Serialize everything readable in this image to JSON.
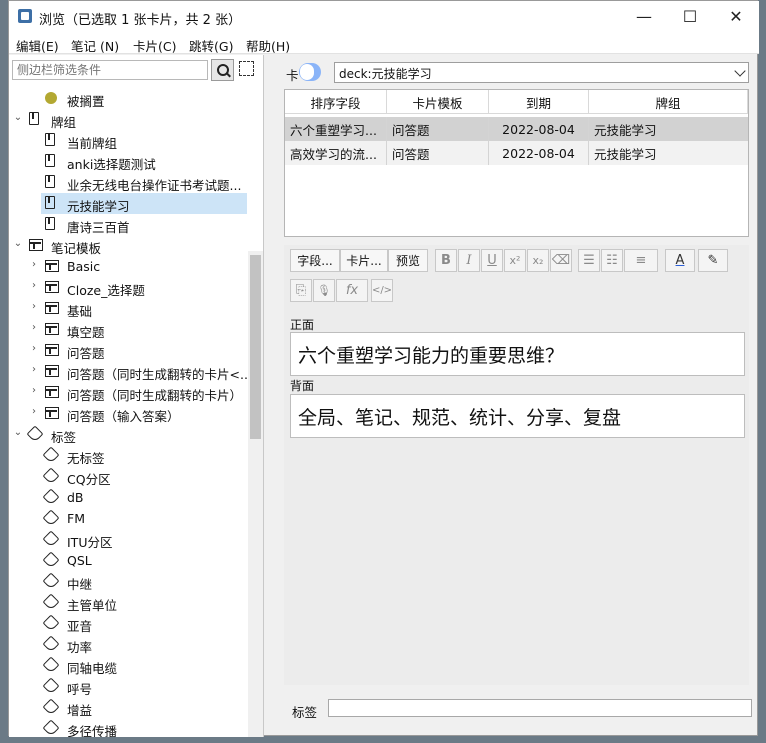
{
  "window": {
    "title": "浏览（已选取 1 张卡片，共 2 张）",
    "minimize_glyph": "—",
    "maximize_glyph": "☐",
    "close_glyph": "✕"
  },
  "menu": [
    "编辑(E)",
    "笔记 (N)",
    "卡片(C)",
    "跳转(G)",
    "帮助(H)"
  ],
  "sidebar": {
    "filter_placeholder": "侧边栏筛选条件",
    "items": [
      {
        "label": "被搁置",
        "icon": "suspended-dot-icon",
        "depth": 1,
        "chevron": ""
      },
      {
        "label": "牌组",
        "icon": "deck-icon",
        "depth": 0,
        "chevron": "⌄"
      },
      {
        "label": "当前牌组",
        "icon": "deck-icon",
        "depth": 1,
        "chevron": ""
      },
      {
        "label": "anki选择题测试",
        "icon": "deck-icon",
        "depth": 1,
        "chevron": ""
      },
      {
        "label": "业余无线电台操作证书考试题...",
        "icon": "deck-icon",
        "depth": 1,
        "chevron": ""
      },
      {
        "label": "元技能学习",
        "icon": "deck-icon",
        "depth": 1,
        "chevron": "",
        "selected": true
      },
      {
        "label": "唐诗三百首",
        "icon": "deck-icon",
        "depth": 1,
        "chevron": ""
      },
      {
        "label": "笔记模板",
        "icon": "notetype-icon",
        "depth": 0,
        "chevron": "⌄"
      },
      {
        "label": "Basic",
        "icon": "notetype-icon",
        "depth": 1,
        "chevron": "›"
      },
      {
        "label": "Cloze_选择题",
        "icon": "notetype-icon",
        "depth": 1,
        "chevron": "›"
      },
      {
        "label": "基础",
        "icon": "notetype-icon",
        "depth": 1,
        "chevron": "›"
      },
      {
        "label": "填空题",
        "icon": "notetype-icon",
        "depth": 1,
        "chevron": "›"
      },
      {
        "label": "问答题",
        "icon": "notetype-icon",
        "depth": 1,
        "chevron": "›"
      },
      {
        "label": "问答题（同时生成翻转的卡片<...",
        "icon": "notetype-icon",
        "depth": 1,
        "chevron": "›"
      },
      {
        "label": "问答题（同时生成翻转的卡片）",
        "icon": "notetype-icon",
        "depth": 1,
        "chevron": "›"
      },
      {
        "label": "问答题（输入答案）",
        "icon": "notetype-icon",
        "depth": 1,
        "chevron": "›"
      },
      {
        "label": "标签",
        "icon": "tag-icon",
        "depth": 0,
        "chevron": "⌄"
      },
      {
        "label": "无标签",
        "icon": "untagged-icon",
        "depth": 1,
        "chevron": ""
      },
      {
        "label": "CQ分区",
        "icon": "tag-icon",
        "depth": 1,
        "chevron": ""
      },
      {
        "label": "dB",
        "icon": "tag-icon",
        "depth": 1,
        "chevron": ""
      },
      {
        "label": "FM",
        "icon": "tag-icon",
        "depth": 1,
        "chevron": ""
      },
      {
        "label": "ITU分区",
        "icon": "tag-icon",
        "depth": 1,
        "chevron": ""
      },
      {
        "label": "QSL",
        "icon": "tag-icon",
        "depth": 1,
        "chevron": ""
      },
      {
        "label": "中继",
        "icon": "tag-icon",
        "depth": 1,
        "chevron": ""
      },
      {
        "label": "主管单位",
        "icon": "tag-icon",
        "depth": 1,
        "chevron": ""
      },
      {
        "label": "亚音",
        "icon": "tag-icon",
        "depth": 1,
        "chevron": ""
      },
      {
        "label": "功率",
        "icon": "tag-icon",
        "depth": 1,
        "chevron": ""
      },
      {
        "label": "同轴电缆",
        "icon": "tag-icon",
        "depth": 1,
        "chevron": ""
      },
      {
        "label": "呼号",
        "icon": "tag-icon",
        "depth": 1,
        "chevron": ""
      },
      {
        "label": "增益",
        "icon": "tag-icon",
        "depth": 1,
        "chevron": ""
      },
      {
        "label": "多径传播",
        "icon": "tag-icon",
        "depth": 1,
        "chevron": ""
      }
    ]
  },
  "search": {
    "mode_label": "卡",
    "query": "deck:元技能学习"
  },
  "table": {
    "columns": [
      "排序字段",
      "卡片模板",
      "到期",
      "牌组"
    ],
    "rows": [
      [
        "六个重塑学习...",
        "问答题",
        "2022-08-04",
        "元技能学习"
      ],
      [
        "高效学习的流...",
        "问答题",
        "2022-08-04",
        "元技能学习"
      ]
    ]
  },
  "editor": {
    "fields_btn": "字段...",
    "cards_btn": "卡片...",
    "preview_btn": "预览",
    "format_glyphs": {
      "bold": "B",
      "italic": "I",
      "underline": "U",
      "superscript": "x²",
      "subscript": "x₂",
      "eraser": "⌫",
      "ul": "☰",
      "ol": "☷",
      "align": "≡",
      "textcolor": "A",
      "highlight": "✎",
      "attach": "⎘",
      "record": "🎙",
      "mathjax": "fx",
      "html": "</>"
    },
    "front_label": "正面",
    "front_value": "六个重塑学习能力的重要思维？",
    "back_label": "背面",
    "back_value": "全局、笔记、规范、统计、分享、复盘",
    "tags_label": "标签"
  },
  "colors": {
    "selected_row": "#cde4f7",
    "accent": "#8ab4f8",
    "suspended_dot": "#b3a832"
  }
}
